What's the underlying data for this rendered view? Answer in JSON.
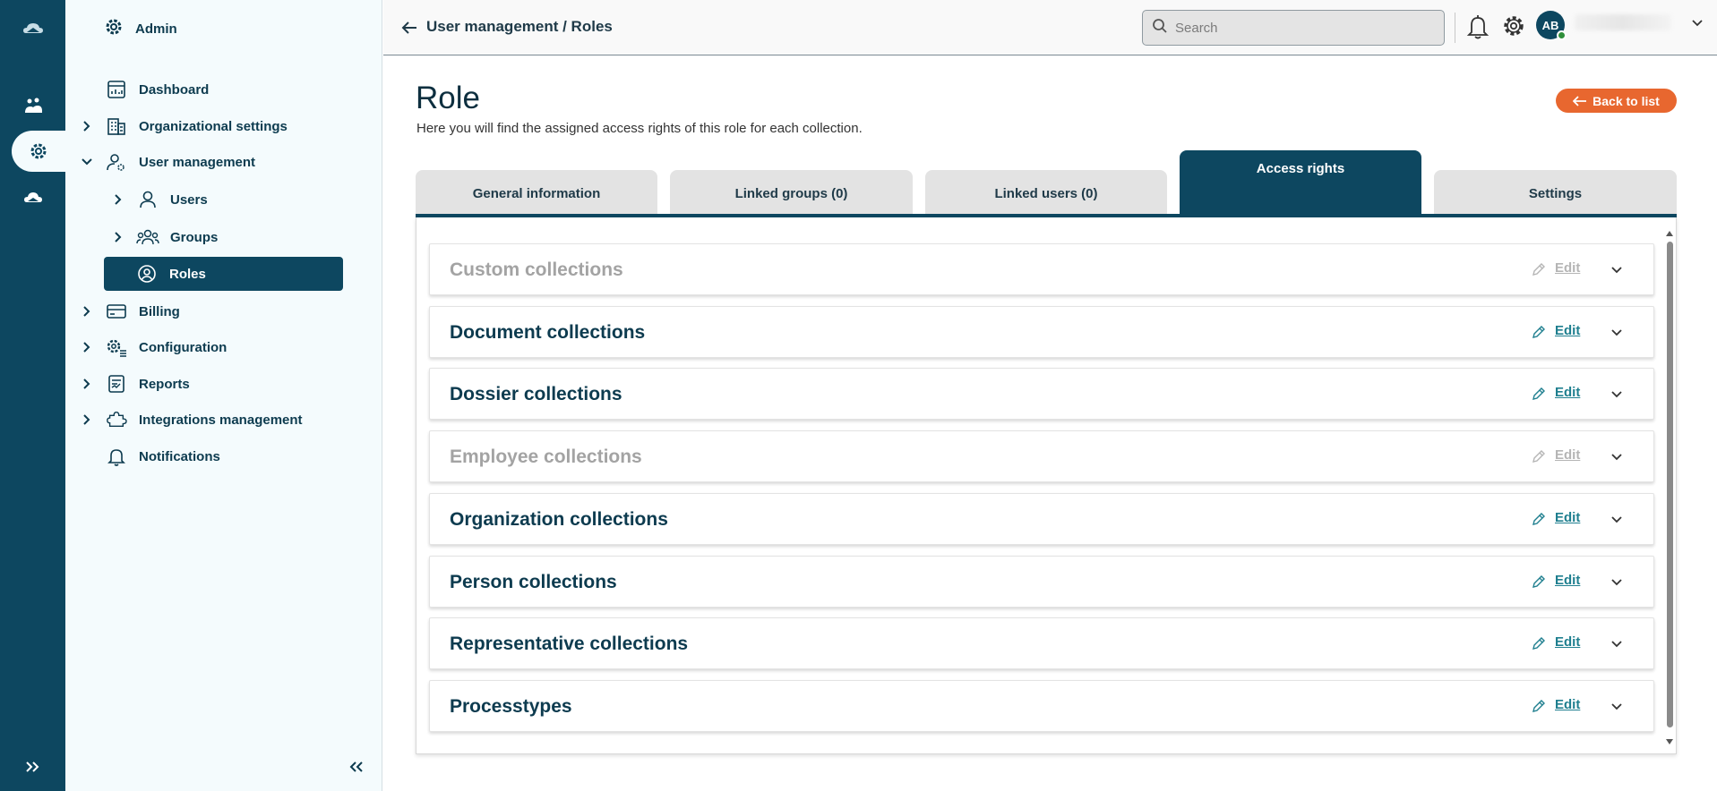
{
  "nav": {
    "header": "Admin",
    "items": [
      {
        "label": "Dashboard"
      },
      {
        "label": "Organizational settings"
      },
      {
        "label": "User management"
      },
      {
        "label": "Users"
      },
      {
        "label": "Groups"
      },
      {
        "label": "Roles"
      },
      {
        "label": "Billing"
      },
      {
        "label": "Configuration"
      },
      {
        "label": "Reports"
      },
      {
        "label": "Integrations management"
      },
      {
        "label": "Notifications"
      }
    ]
  },
  "topbar": {
    "breadcrumb": "User management / Roles",
    "search_placeholder": "Search",
    "avatar_initials": "AB"
  },
  "page": {
    "title": "Role",
    "subtitle": "Here you will find the assigned access rights of this role for each collection.",
    "back_button": "Back to list"
  },
  "tabs": [
    {
      "label": "General information"
    },
    {
      "label": "Linked groups (0)"
    },
    {
      "label": "Linked users (0)"
    },
    {
      "label": "Access rights"
    },
    {
      "label": "Settings"
    }
  ],
  "collections": [
    {
      "name": "Custom collections",
      "edit": "Edit",
      "enabled": false
    },
    {
      "name": "Document collections",
      "edit": "Edit",
      "enabled": true
    },
    {
      "name": "Dossier collections",
      "edit": "Edit",
      "enabled": true
    },
    {
      "name": "Employee collections",
      "edit": "Edit",
      "enabled": false
    },
    {
      "name": "Organization collections",
      "edit": "Edit",
      "enabled": true
    },
    {
      "name": "Person collections",
      "edit": "Edit",
      "enabled": true
    },
    {
      "name": "Representative collections",
      "edit": "Edit",
      "enabled": true
    },
    {
      "name": "Processtypes",
      "edit": "Edit",
      "enabled": true
    }
  ],
  "colors": {
    "primary": "#0d4760",
    "accent": "#e8672f",
    "link": "#1f7f8f",
    "nav_bg": "#f4fbfd",
    "status_online": "#2f8f3a"
  },
  "icons": {
    "rail": [
      "cloud-logo-icon",
      "people-cloud-icon",
      "gear-icon",
      "cloud-icon",
      "expand-double-chevron-icon"
    ],
    "nav": [
      "gear-icon",
      "dashboard-icon",
      "building-icon",
      "user-gear-icon",
      "user-icon",
      "groups-icon",
      "role-icon",
      "billing-card-icon",
      "configuration-icon",
      "reports-icon",
      "puzzle-icon",
      "bell-icon"
    ]
  }
}
